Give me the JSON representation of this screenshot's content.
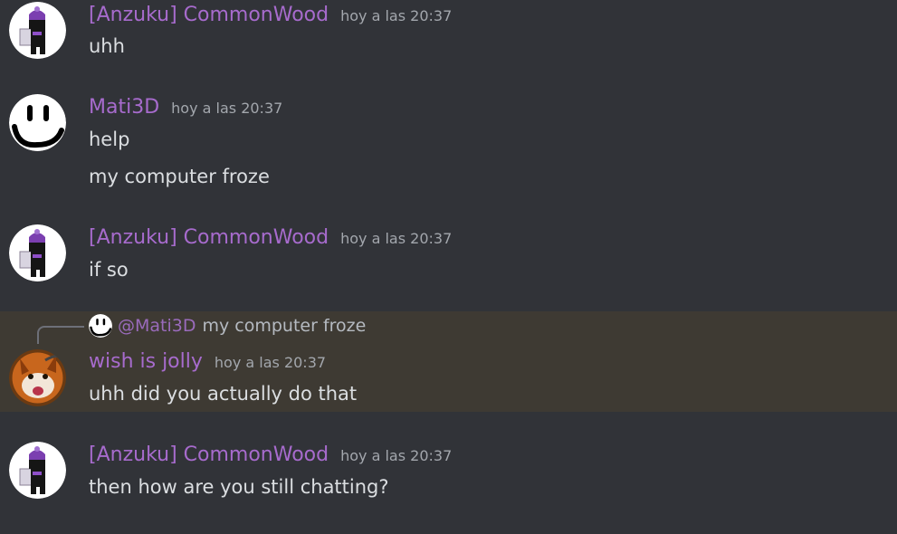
{
  "messages": [
    {
      "username": "[Anzuku] CommonWood",
      "timestamp": "hoy a las 20:37",
      "avatar": "purple-hat-figure-avatar",
      "lines": [
        "uhh"
      ]
    },
    {
      "username": "Mati3D",
      "timestamp": "hoy a las 20:37",
      "avatar": "smiley-face-avatar",
      "lines": [
        "help",
        "my computer froze"
      ]
    },
    {
      "username": "[Anzuku] CommonWood",
      "timestamp": "hoy a las 20:37",
      "avatar": "purple-hat-figure-avatar",
      "lines": [
        "if so"
      ]
    },
    {
      "username": "wish is jolly",
      "timestamp": "hoy a las 20:37",
      "avatar": "fox-avatar",
      "highlighted": true,
      "reply": {
        "mention": "@Mati3D",
        "text": "my computer froze",
        "avatar": "smiley-face-avatar"
      },
      "lines": [
        "uhh did you actually do that"
      ]
    },
    {
      "username": "[Anzuku] CommonWood",
      "timestamp": "hoy a las 20:37",
      "avatar": "purple-hat-figure-avatar",
      "lines": [
        "then how are you still chatting?"
      ]
    }
  ],
  "colors": {
    "background": "#313338",
    "highlight": "#3e3a33",
    "username": "#a76bcd",
    "text": "#dbdee1",
    "timestamp": "#a3a7ad"
  }
}
